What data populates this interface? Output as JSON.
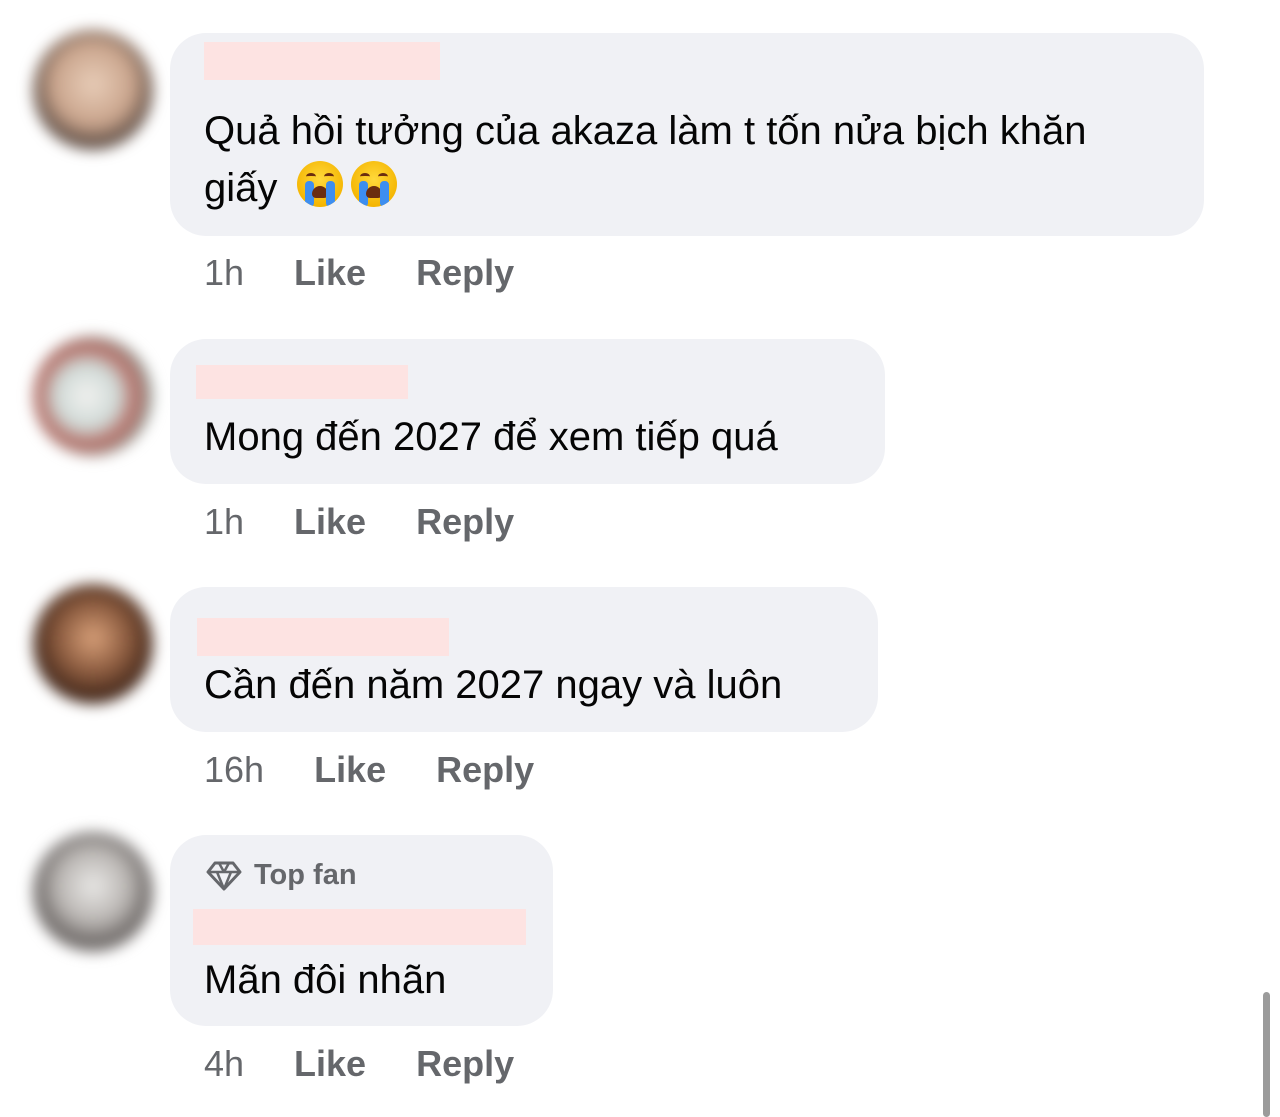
{
  "comments": [
    {
      "text": "Quả hồi tưởng của akaza làm t tốn nửa bịch khăn giấy",
      "emojis": [
        "loudly-crying-face",
        "loudly-crying-face"
      ],
      "time": "1h",
      "like": "Like",
      "reply": "Reply",
      "avatar_color": "#c9a48c"
    },
    {
      "text": "Mong đến 2027 để xem tiếp quá",
      "time": "1h",
      "like": "Like",
      "reply": "Reply",
      "avatar_color": "#9fb8b4"
    },
    {
      "text": "Cần đến năm 2027 ngay và luôn",
      "time": "16h",
      "like": "Like",
      "reply": "Reply",
      "avatar_color": "#7a4a32"
    },
    {
      "badge": "Top fan",
      "text": "Mãn đôi nhãn",
      "time": "4h",
      "like": "Like",
      "reply": "Reply",
      "avatar_color": "#b9b5b2"
    }
  ],
  "colors": {
    "bubble": "#f0f1f5",
    "redaction": "#fde3e2",
    "meta_text": "#65676b",
    "text": "#050505"
  }
}
